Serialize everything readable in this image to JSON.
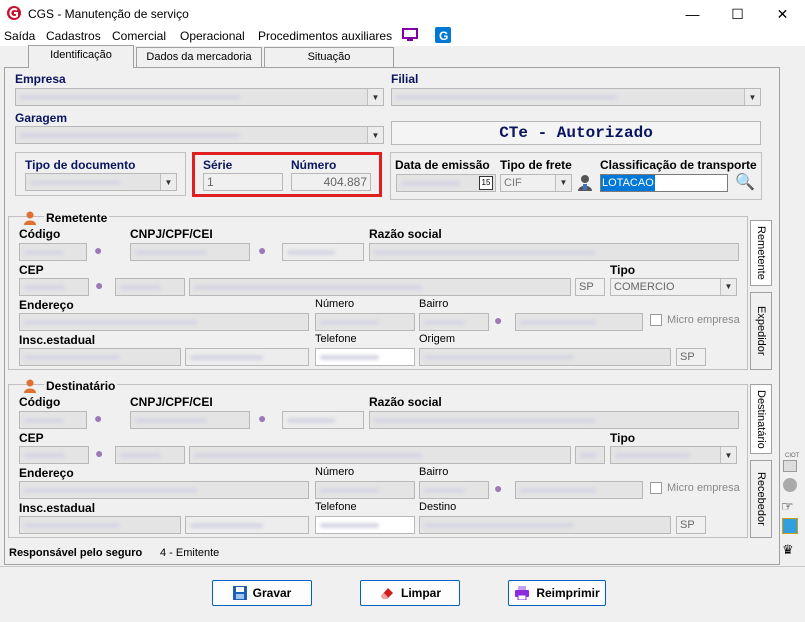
{
  "window": {
    "title": "CGS - Manutenção de serviço"
  },
  "menu": [
    "Saída",
    "Cadastros",
    "Comercial",
    "Operacional",
    "Procedimentos auxiliares"
  ],
  "tabs": [
    "Identificação",
    "Dados da mercadoria",
    "Situação"
  ],
  "empresa": {
    "label": "Empresa"
  },
  "filial": {
    "label": "Filial"
  },
  "garagem": {
    "label": "Garagem"
  },
  "status": {
    "text": "CTe - Autorizado"
  },
  "tipo_documento": {
    "label": "Tipo de documento"
  },
  "serie": {
    "label": "Série",
    "value": "1"
  },
  "numero": {
    "label": "Número",
    "value": "404.887"
  },
  "data_emissao": {
    "label": "Data de emissão",
    "cal": "15"
  },
  "tipo_frete": {
    "label": "Tipo de frete",
    "value": "CIF"
  },
  "classificacao": {
    "label": "Classificação de transporte",
    "value": "LOTACAO"
  },
  "remetente": {
    "title": "Remetente",
    "codigo": "Código",
    "cnpj": "CNPJ/CPF/CEI",
    "razao": "Razão social",
    "cep": "CEP",
    "uf": "SP",
    "tipo_label": "Tipo",
    "tipo_value": "COMERCIO",
    "endereco": "Endereço",
    "numero": "Número",
    "bairro": "Bairro",
    "micro": "Micro empresa",
    "insc": "Insc.estadual",
    "telefone": "Telefone",
    "origem": "Origem",
    "uf2": "SP"
  },
  "destinatario": {
    "title": "Destinatário",
    "codigo": "Código",
    "cnpj": "CNPJ/CPF/CEI",
    "razao": "Razão social",
    "cep": "CEP",
    "tipo_label": "Tipo",
    "endereco": "Endereço",
    "numero": "Número",
    "bairro": "Bairro",
    "micro": "Micro empresa",
    "insc": "Insc.estadual",
    "telefone": "Telefone",
    "destino": "Destino",
    "uf2": "SP"
  },
  "side_tabs": [
    "Remetente",
    "Expedidor",
    "Destinatário",
    "Recebedor"
  ],
  "seguro": {
    "label": "Responsável pelo seguro",
    "value": "4 - Emitente"
  },
  "buttons": {
    "gravar": "Gravar",
    "limpar": "Limpar",
    "reimprimir": "Reimprimir"
  },
  "right_tools": {
    "label": "CIOT"
  }
}
